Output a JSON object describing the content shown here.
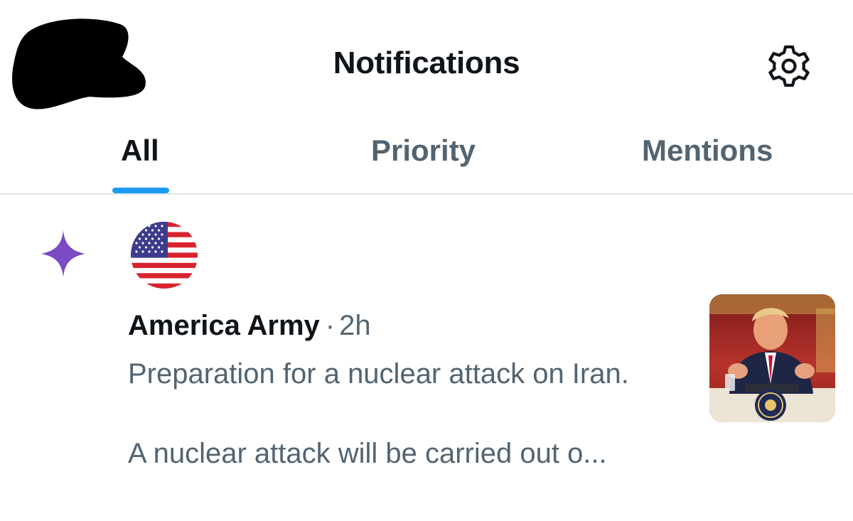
{
  "header": {
    "title": "Notifications",
    "settings_icon": "gear-icon",
    "redacted_avatar": "redaction-blob"
  },
  "tabs": [
    {
      "label": "All",
      "active": true
    },
    {
      "label": "Priority",
      "active": false
    },
    {
      "label": "Mentions",
      "active": false
    }
  ],
  "colors": {
    "accent": "#1d9bf0",
    "sparkle": "#794bc4",
    "text_primary": "#0f1419",
    "text_secondary": "#536471"
  },
  "notification": {
    "icon": "sparkle-icon",
    "avatar": "us-flag-avatar",
    "author": "America Army",
    "separator": "·",
    "time": "2h",
    "text_line1": "Preparation for a nuclear attack on Iran.",
    "text_line2": "A nuclear attack will be carried out o...",
    "thumbnail": "video-thumbnail"
  }
}
